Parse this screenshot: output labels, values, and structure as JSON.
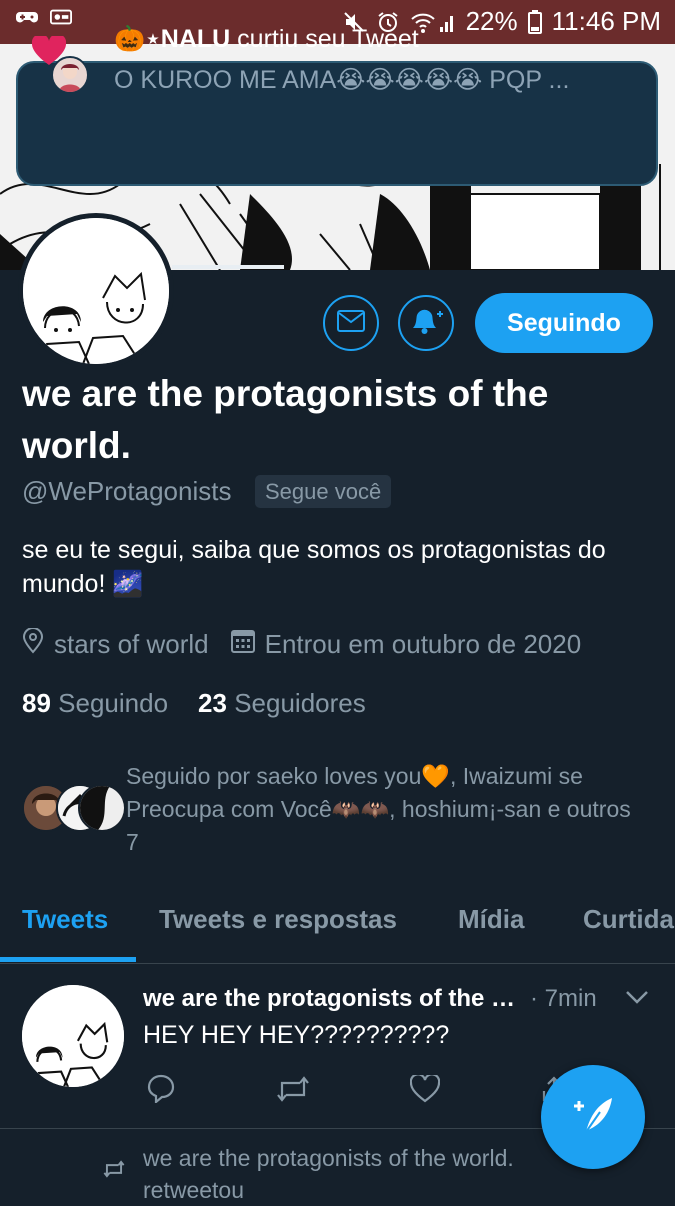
{
  "status_bar": {
    "battery": "22%",
    "time": "11:46 PM"
  },
  "notification": {
    "actor": "🎃⋆NALU",
    "action": "curtiu seu Tweet",
    "preview": "O KUROO ME AMA😭😭😭😭😭 PQP ..."
  },
  "profile": {
    "name": "we are the protagonists of the world.",
    "handle": "@WeProtagonists",
    "follows_you": "Segue você",
    "bio": "se eu te segui, saiba que somos os protagonistas do mundo! 🌌",
    "location": "stars of world",
    "joined": "Entrou em outubro de 2020",
    "following_count": "89",
    "following_label": "Seguindo",
    "followers_count": "23",
    "followers_label": "Seguidores",
    "follow_button": "Seguindo",
    "followed_by": "Seguido por saeko loves you🧡, Iwaizumi se Preocupa com Você🦇🦇, hoshium¡-san e outros 7"
  },
  "tabs": [
    {
      "label": "Tweets"
    },
    {
      "label": "Tweets e respostas"
    },
    {
      "label": "Mídia"
    },
    {
      "label": "Curtidas"
    }
  ],
  "tweet": {
    "name": "we are the protagonists of the world.",
    "time": "· 7min",
    "text": "HEY HEY HEY??????????"
  },
  "retweet": {
    "text": "we are the protagonists of the world. retweetou"
  },
  "colors": {
    "background": "#15202b",
    "accent": "#1da1f2",
    "status_bar": "#6b2c2c",
    "secondary_text": "#8899a6"
  },
  "icons": {
    "mail": "mail-icon",
    "bell": "bell-plus-icon",
    "location": "location-pin-icon",
    "calendar": "calendar-icon",
    "compose": "compose-feather-icon"
  }
}
